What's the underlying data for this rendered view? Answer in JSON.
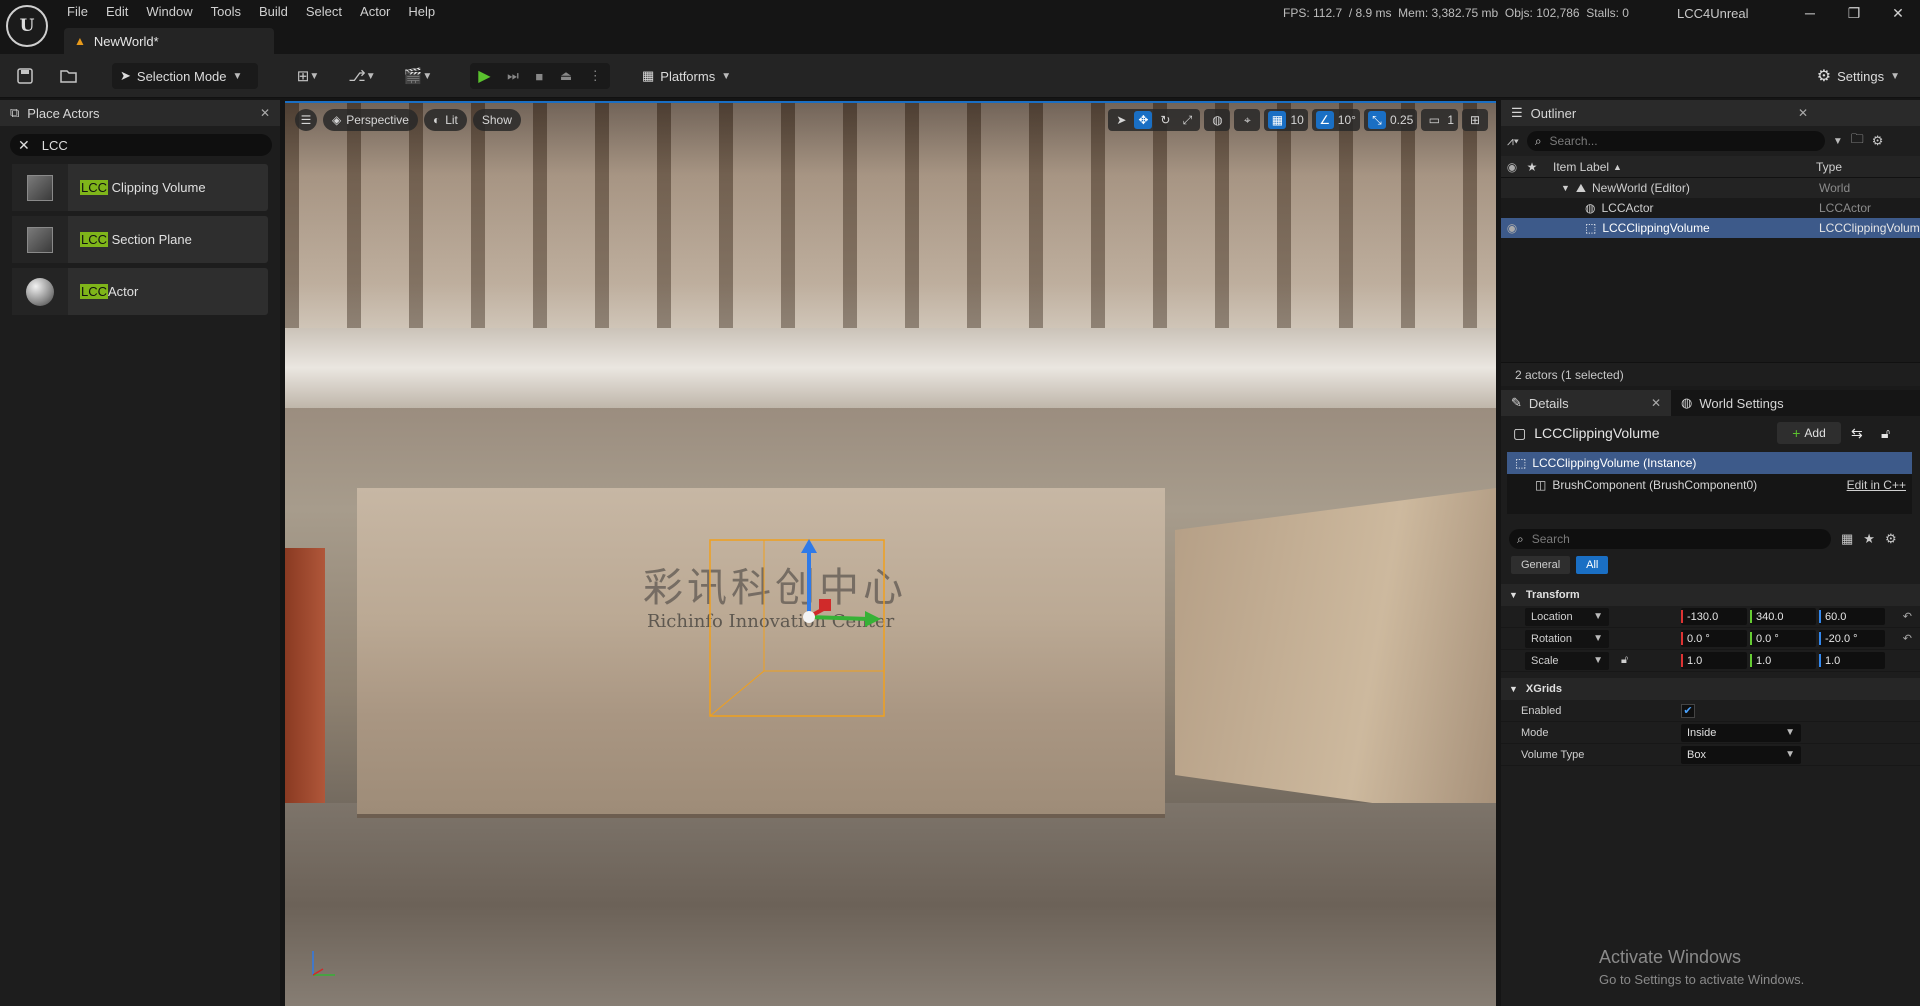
{
  "titlebar": {
    "menus": [
      "File",
      "Edit",
      "Window",
      "Tools",
      "Build",
      "Select",
      "Actor",
      "Help"
    ],
    "level_tab": "NewWorld*",
    "stats": "FPS: 112.7  / 8.9 ms  Mem: 3,382.75 mb  Objs: 102,786  Stalls: 0",
    "project_name": "LCC4Unreal",
    "logo_text": "U"
  },
  "toolbar": {
    "selection_mode": "Selection Mode",
    "platforms": "Platforms",
    "settings": "Settings"
  },
  "place_actors": {
    "tab_label": "Place Actors",
    "search_value": "LCC",
    "items": [
      {
        "highlight": "LCC",
        "rest": " Clipping Volume",
        "thumb": "cube"
      },
      {
        "highlight": "LCC",
        "rest": " Section Plane",
        "thumb": "cube"
      },
      {
        "highlight": "LCC",
        "rest": "Actor",
        "thumb": "sphere"
      }
    ]
  },
  "viewport": {
    "perspective": "Perspective",
    "lit": "Lit",
    "show": "Show",
    "grid_snap": "10",
    "rotation_snap": "10°",
    "scale_snap": "0.25",
    "camera_speed": "1",
    "sign_cn": "彩讯科创中心",
    "sign_en": "Richinfo Innovation Center"
  },
  "outliner": {
    "tab_label": "Outliner",
    "search_placeholder": "Search...",
    "col_label": "Item Label",
    "col_type": "Type",
    "rows": [
      {
        "label": "NewWorld (Editor)",
        "type": "World"
      },
      {
        "label": "LCCActor",
        "type": "LCCActor"
      },
      {
        "label": "LCCClippingVolume",
        "type": "LCCClippingVolume"
      }
    ],
    "footer": "2 actors (1 selected)"
  },
  "details": {
    "tab_label": "Details",
    "world_settings": "World Settings",
    "actor_name": "LCCClippingVolume",
    "add_label": "Add",
    "instance_label": "LCCClippingVolume (Instance)",
    "component_label": "BrushComponent (BrushComponent0)",
    "edit_cpp": "Edit in C++",
    "search_placeholder": "Search",
    "filter_general": "General",
    "filter_all": "All",
    "transform_header": "Transform",
    "location_label": "Location",
    "location": [
      "-130.0",
      "340.0",
      "60.0"
    ],
    "rotation_label": "Rotation",
    "rotation": [
      "0.0 °",
      "0.0 °",
      "-20.0 °"
    ],
    "scale_label": "Scale",
    "scale": [
      "1.0",
      "1.0",
      "1.0"
    ],
    "xgrids_header": "XGrids",
    "enabled_label": "Enabled",
    "mode_label": "Mode",
    "mode_value": "Inside",
    "volume_type_label": "Volume Type",
    "volume_type_value": "Box"
  },
  "watermark": {
    "line1": "Activate Windows",
    "line2": "Go to Settings to activate Windows."
  }
}
